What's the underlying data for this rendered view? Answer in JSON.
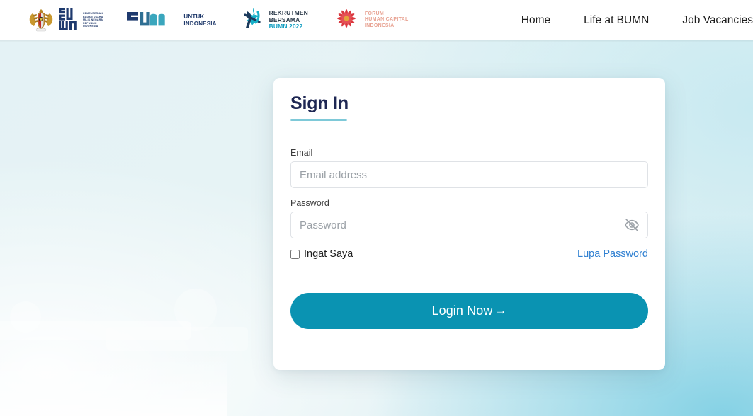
{
  "header": {
    "logos": [
      {
        "name": "kemenbumn-logo",
        "emblem": "garuda-pancasila-emblem",
        "mark": "BUMN",
        "caption": "KEMENTERIAN\nBADAN USAHA\nMILIK NEGARA\nREPUBLIK\nINDONESIA"
      },
      {
        "name": "bumn-untuk-indonesia-logo",
        "mark": "BUMN",
        "caption_line1": "UNTUK",
        "caption_line2": "INDONESIA"
      },
      {
        "name": "rekrutmen-bersama-bumn-logo",
        "caption_line1": "REKRUTMEN",
        "caption_line2": "BERSAMA",
        "caption_line3": "BUMN 2022"
      },
      {
        "name": "forum-human-capital-indonesia-logo",
        "caption_line1": "FORUM",
        "caption_line2": "HUMAN CAPITAL",
        "caption_line3": "INDONESIA"
      }
    ],
    "nav": [
      {
        "label": "Home"
      },
      {
        "label": "Life at BUMN"
      },
      {
        "label": "Job Vacancies"
      }
    ]
  },
  "card": {
    "title": "Sign In",
    "email": {
      "label": "Email",
      "placeholder": "Email address",
      "value": ""
    },
    "password": {
      "label": "Password",
      "placeholder": "Password",
      "value": "",
      "toggle_icon": "eye-off-icon"
    },
    "remember": {
      "label": "Ingat Saya",
      "checked": false
    },
    "forgot_password_label": "Lupa Password",
    "submit": {
      "label": "Login Now",
      "arrow": "→"
    }
  },
  "colors": {
    "accent_teal": "#0a93b2",
    "title_navy": "#1e2753",
    "underline_teal": "#7ec9d8",
    "link_blue": "#2e7fd1",
    "bg_cyan": "#cfe9f0"
  }
}
